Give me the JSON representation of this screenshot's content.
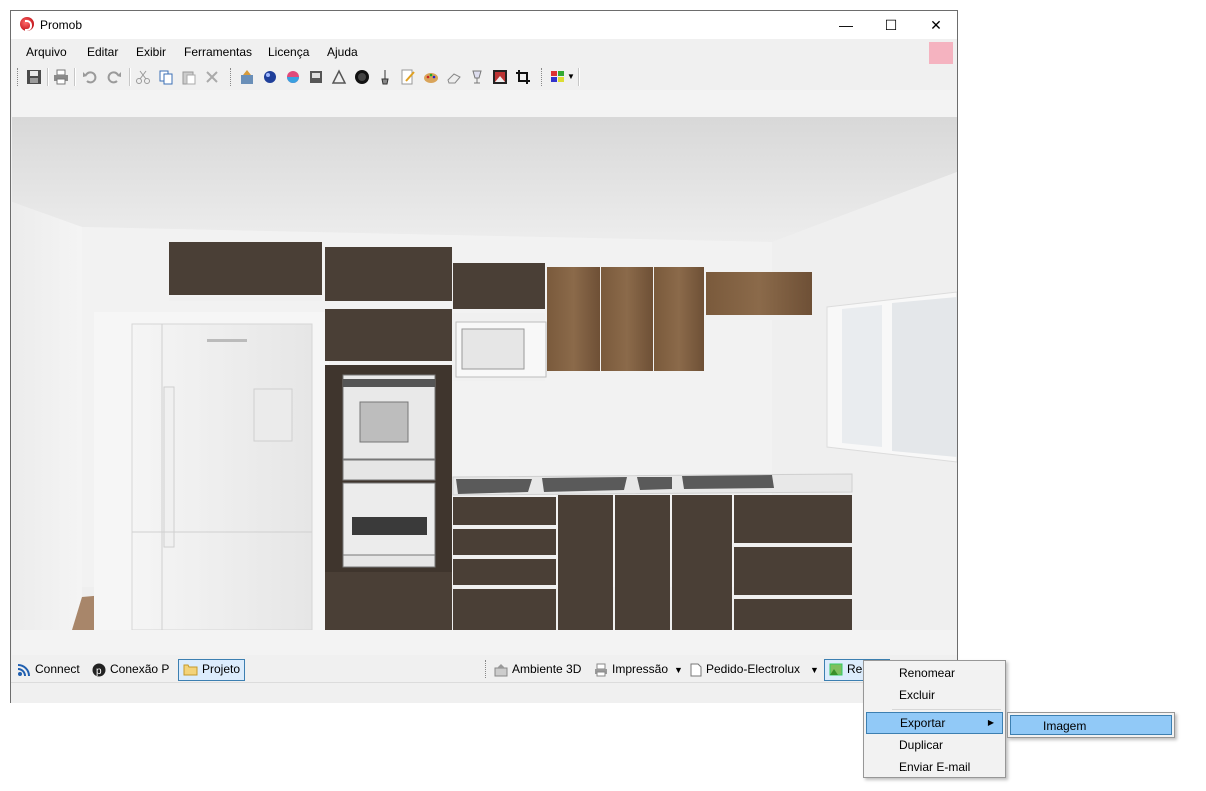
{
  "window": {
    "title": "Promob",
    "minimize_glyph": "—",
    "maximize_glyph": "☐",
    "close_glyph": "✕"
  },
  "menubar": {
    "items": [
      "Arquivo",
      "Editar",
      "Exibir",
      "Ferramentas",
      "Licença",
      "Ajuda"
    ]
  },
  "toolbar": {
    "icons": [
      "save-icon",
      "print-icon",
      "undo-icon",
      "redo-icon",
      "cut-icon",
      "copy-icon",
      "paste-icon",
      "delete-icon",
      "scene-icon",
      "sphere-icon",
      "color-sphere-icon",
      "render-icon",
      "triangle-icon",
      "light-icon",
      "lamp-icon",
      "edit-icon",
      "palette-icon",
      "eraser-icon",
      "glass-icon",
      "photo-icon",
      "crop-icon",
      "layout-icon"
    ]
  },
  "bottom_tabs": {
    "connect": "Connect",
    "conexao": "Conexão P",
    "projeto": "Projeto",
    "ambiente": "Ambiente 3D",
    "impressao": "Impressão",
    "pedido": "Pedido-Electrolux",
    "render": "Ren"
  },
  "context_menu": {
    "renomear": "Renomear",
    "excluir": "Excluir",
    "exportar": "Exportar",
    "duplicar": "Duplicar",
    "enviar": "Enviar E-mail"
  },
  "submenu": {
    "imagem": "Imagem"
  },
  "colors": {
    "accent": "#91c9f7",
    "cabinet_dark": "#4a3e35",
    "cabinet_wood": "#7a5c40"
  }
}
